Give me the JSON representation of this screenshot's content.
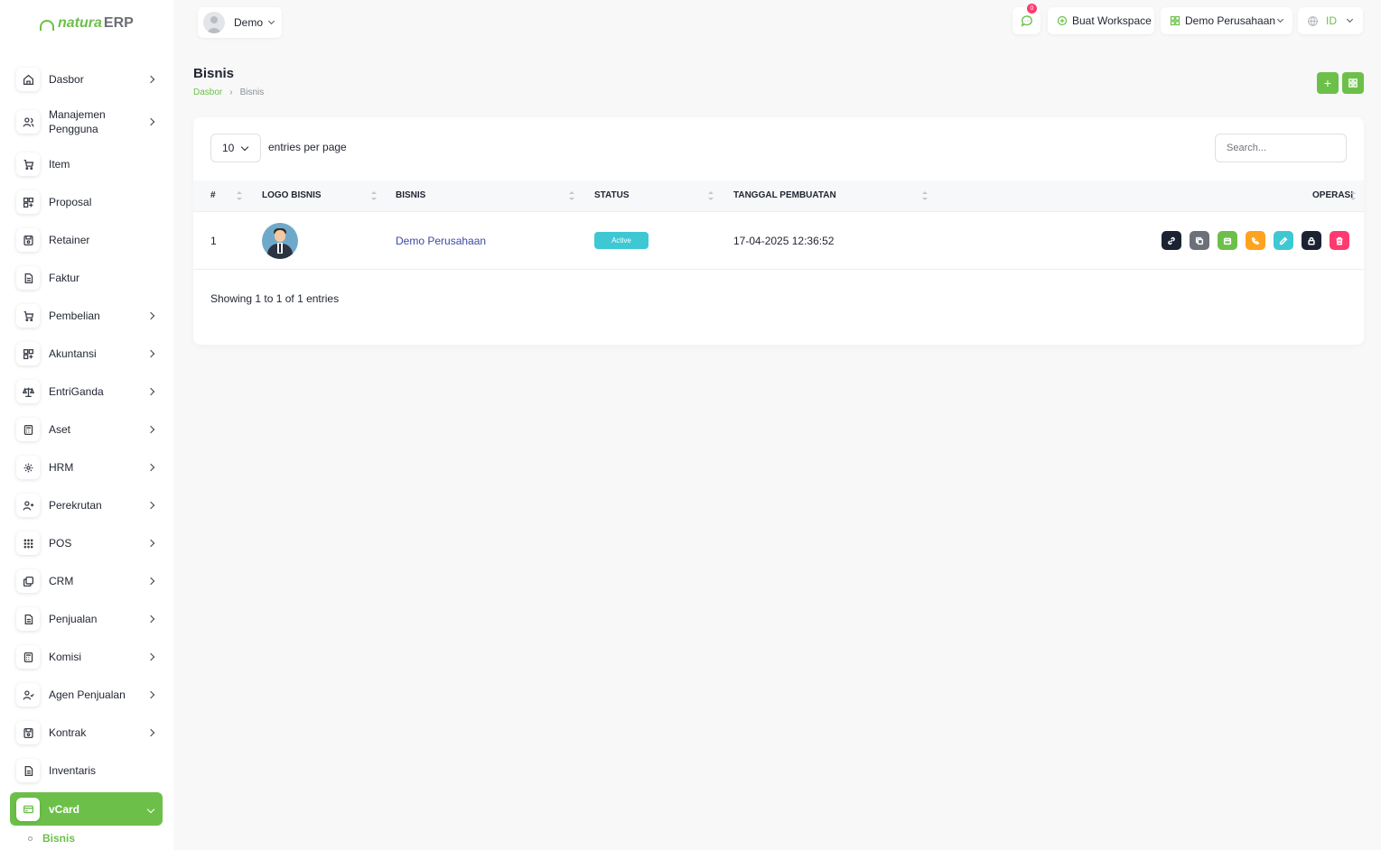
{
  "app": {
    "logo_natura": "natura",
    "logo_erp": "ERP"
  },
  "header": {
    "user_name": "Demo",
    "notification_count": "0",
    "create_workspace_label": "Buat Workspace",
    "company_label": "Demo Perusahaan",
    "language_label": "ID"
  },
  "sidebar": {
    "items": [
      {
        "label": "Dasbor",
        "icon": "home-icon"
      },
      {
        "label": "Manajemen Pengguna",
        "icon": "users-icon"
      },
      {
        "label": "Item",
        "icon": "cart-icon"
      },
      {
        "label": "Proposal",
        "icon": "grid-icon"
      },
      {
        "label": "Retainer",
        "icon": "save-icon"
      },
      {
        "label": "Faktur",
        "icon": "file-icon"
      },
      {
        "label": "Pembelian",
        "icon": "cart-icon"
      },
      {
        "label": "Akuntansi",
        "icon": "grid-icon"
      },
      {
        "label": "EntriGanda",
        "icon": "scale-icon"
      },
      {
        "label": "Aset",
        "icon": "calculator-icon"
      },
      {
        "label": "HRM",
        "icon": "hrm-icon"
      },
      {
        "label": "Perekrutan",
        "icon": "user-plus-icon"
      },
      {
        "label": "POS",
        "icon": "dots-grid-icon"
      },
      {
        "label": "CRM",
        "icon": "layers-icon"
      },
      {
        "label": "Penjualan",
        "icon": "file-icon"
      },
      {
        "label": "Komisi",
        "icon": "calculator-icon"
      },
      {
        "label": "Agen Penjualan",
        "icon": "user-check-icon"
      },
      {
        "label": "Kontrak",
        "icon": "save-icon"
      },
      {
        "label": "Inventaris",
        "icon": "file-icon"
      },
      {
        "label": "vCard",
        "icon": "card-icon"
      }
    ],
    "sub_active": "Bisnis"
  },
  "page": {
    "title": "Bisnis",
    "breadcrumb": {
      "home": "Dasbor",
      "sep": "›",
      "current": "Bisnis"
    },
    "add_label": "+"
  },
  "table": {
    "per_page": "10",
    "per_page_label": "entries per page",
    "search_placeholder": "Search...",
    "columns": [
      "#",
      "LOGO BISNIS",
      "BISNIS",
      "STATUS",
      "TANGGAL PEMBUATAN",
      "OPERASI"
    ],
    "rows": [
      {
        "no": "1",
        "business": "Demo Perusahaan",
        "status": "Active",
        "created": "17-04-2025 12:36:52"
      }
    ],
    "showing": "Showing 1 to 1 of 1 entries"
  },
  "colors": {
    "accent": "#6cc04a",
    "status_active": "#3ec8d4",
    "op_link": "#1b2333",
    "op_copy": "#6b7079",
    "op_calendar": "#6cc04a",
    "op_phone": "#ffa21d",
    "op_edit": "#3ec8d4",
    "op_lock": "#1b2333",
    "op_delete": "#ff3a6e"
  }
}
